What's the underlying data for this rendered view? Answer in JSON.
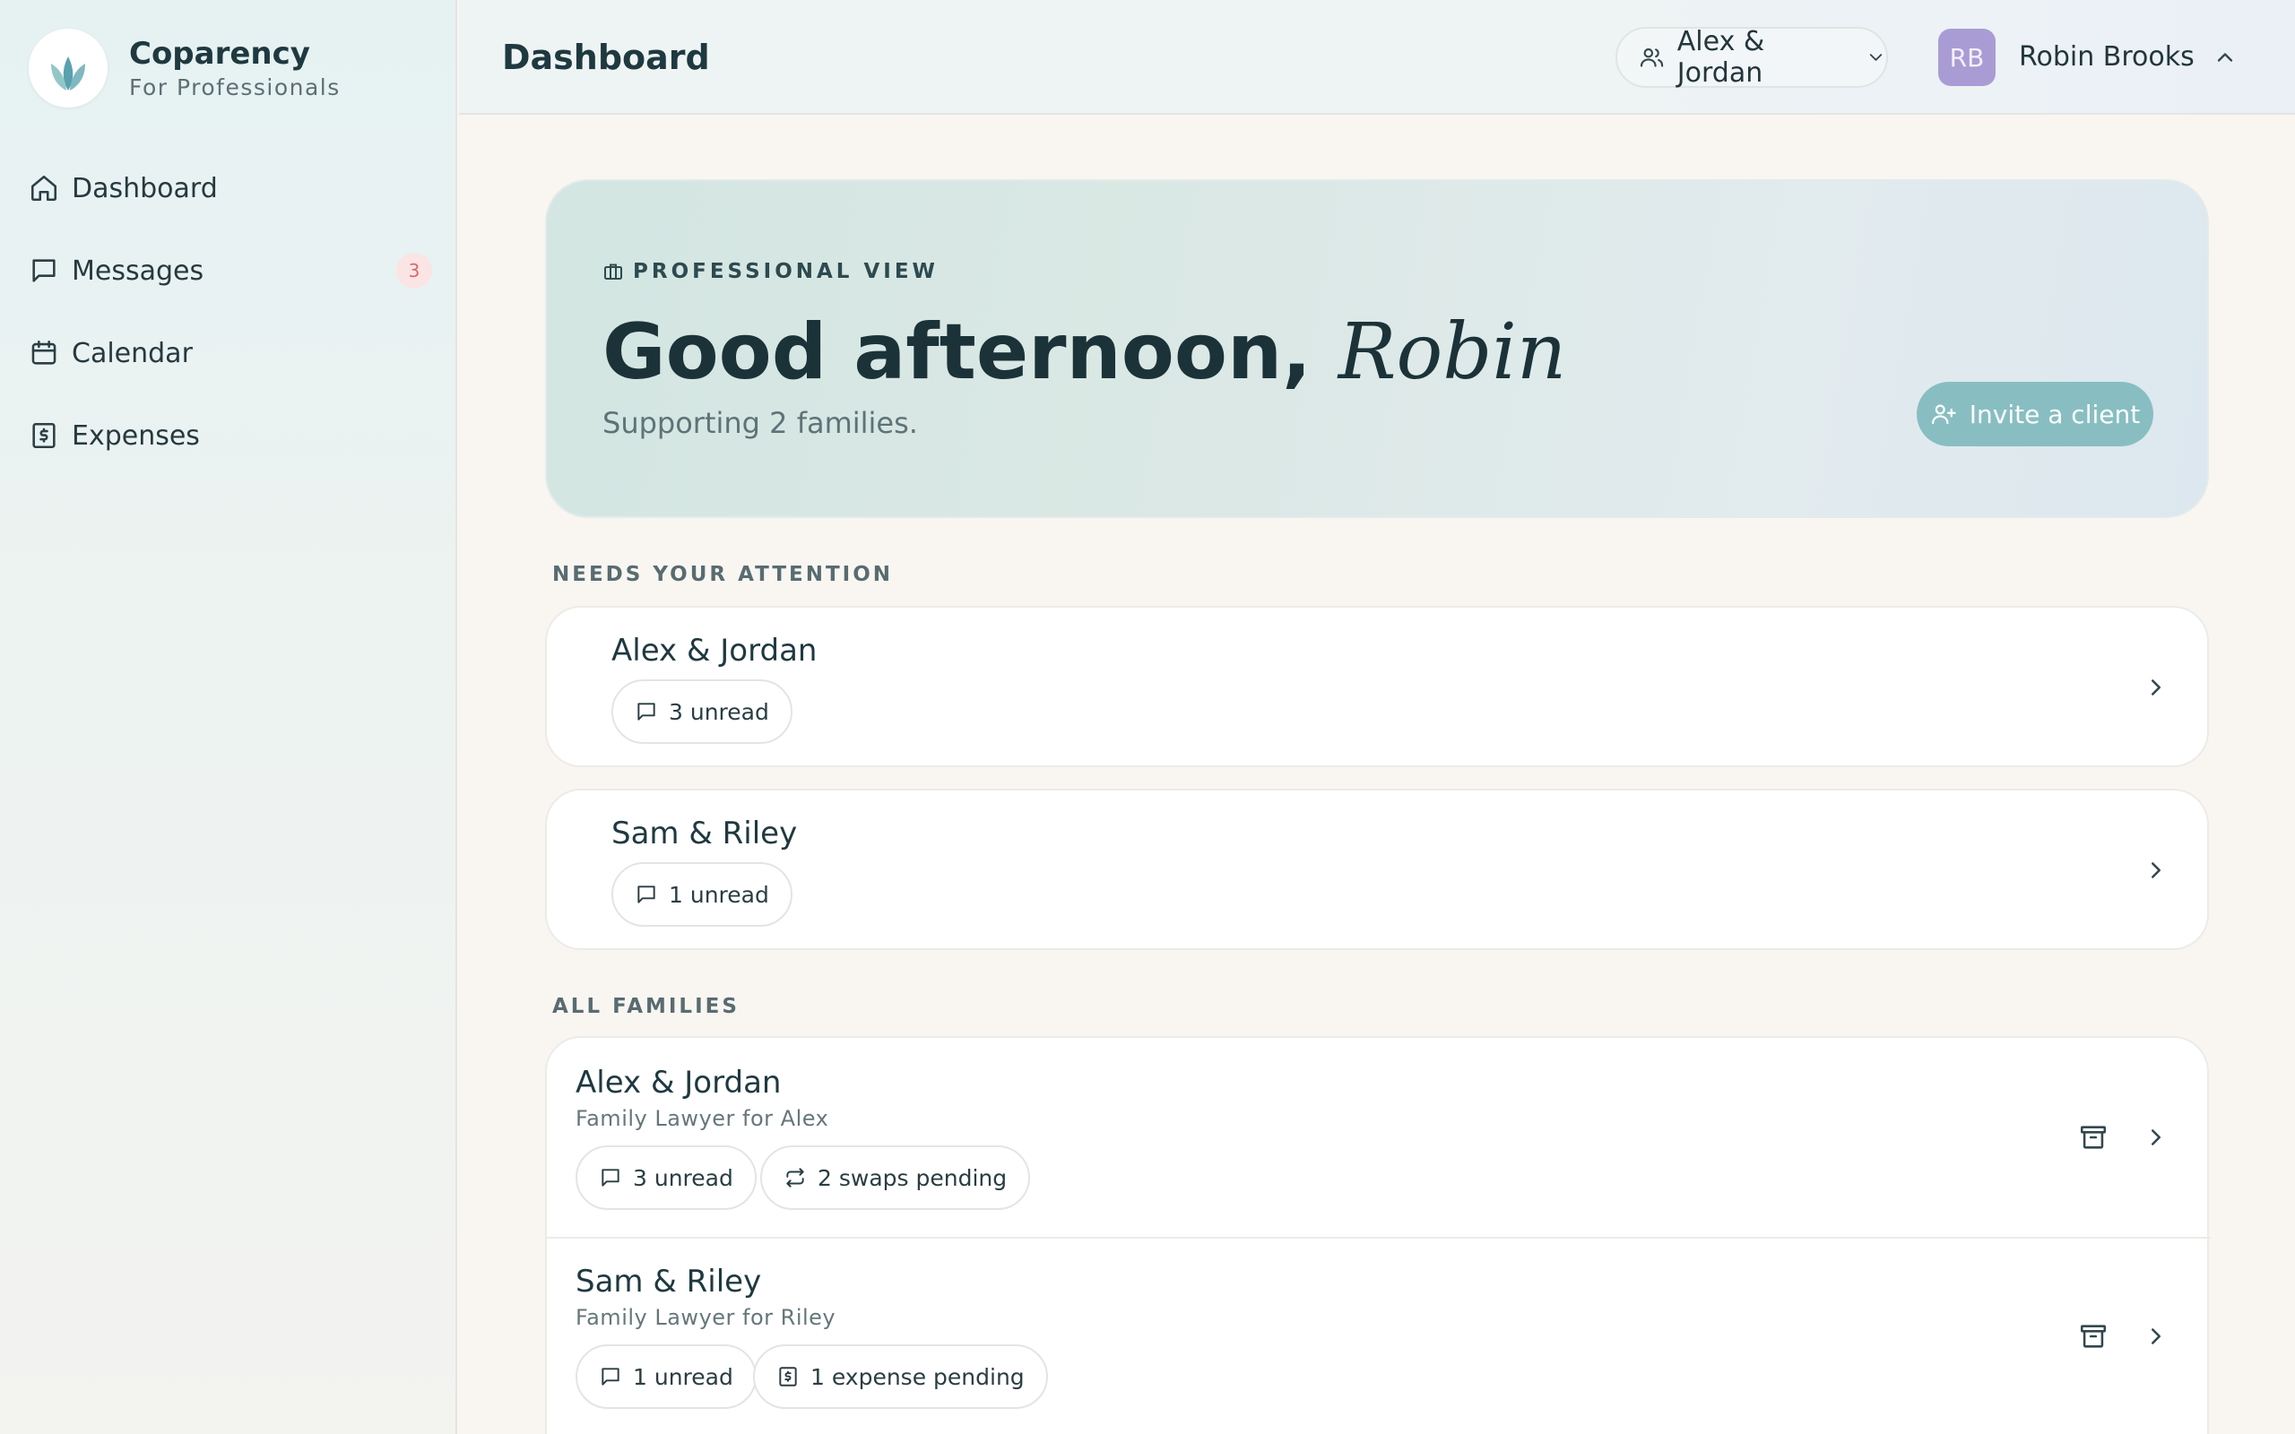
{
  "sidebar": {
    "brand": {
      "name": "Coparency",
      "subtitle": "For Professionals"
    },
    "items": [
      {
        "label": "Dashboard",
        "icon": "home-icon"
      },
      {
        "label": "Messages",
        "icon": "message-icon",
        "badge": "3"
      },
      {
        "label": "Calendar",
        "icon": "calendar-icon"
      },
      {
        "label": "Expenses",
        "icon": "receipt-dollar-icon"
      }
    ]
  },
  "header": {
    "title": "Dashboard",
    "family_selector": "Alex & Jordan",
    "user": {
      "initials": "RB",
      "name": "Robin Brooks",
      "avatar_color": "#a99cd4"
    }
  },
  "hero": {
    "eyebrow": "PROFESSIONAL VIEW",
    "greeting": "Good afternoon,",
    "name": "Robin",
    "subtitle": "Supporting 2 families.",
    "invite_label": "Invite a client"
  },
  "attention": {
    "label": "NEEDS YOUR ATTENTION",
    "items": [
      {
        "family": "Alex & Jordan",
        "unread": "3 unread"
      },
      {
        "family": "Sam & Riley",
        "unread": "1 unread"
      }
    ]
  },
  "families": {
    "label": "ALL FAMILIES",
    "items": [
      {
        "family": "Alex & Jordan",
        "role": "Family Lawyer for Alex",
        "unread": "3 unread",
        "extra": "2 swaps pending",
        "extra_icon": "swap-icon"
      },
      {
        "family": "Sam & Riley",
        "role": "Family Lawyer for Riley",
        "unread": "1 unread",
        "extra": "1 expense pending",
        "extra_icon": "receipt-dollar-icon"
      }
    ]
  },
  "colors": {
    "accent": "#88bec2",
    "badge_bg": "#fbe4e4",
    "badge_text": "#d66b6b",
    "avatar": "#a99cd4"
  }
}
